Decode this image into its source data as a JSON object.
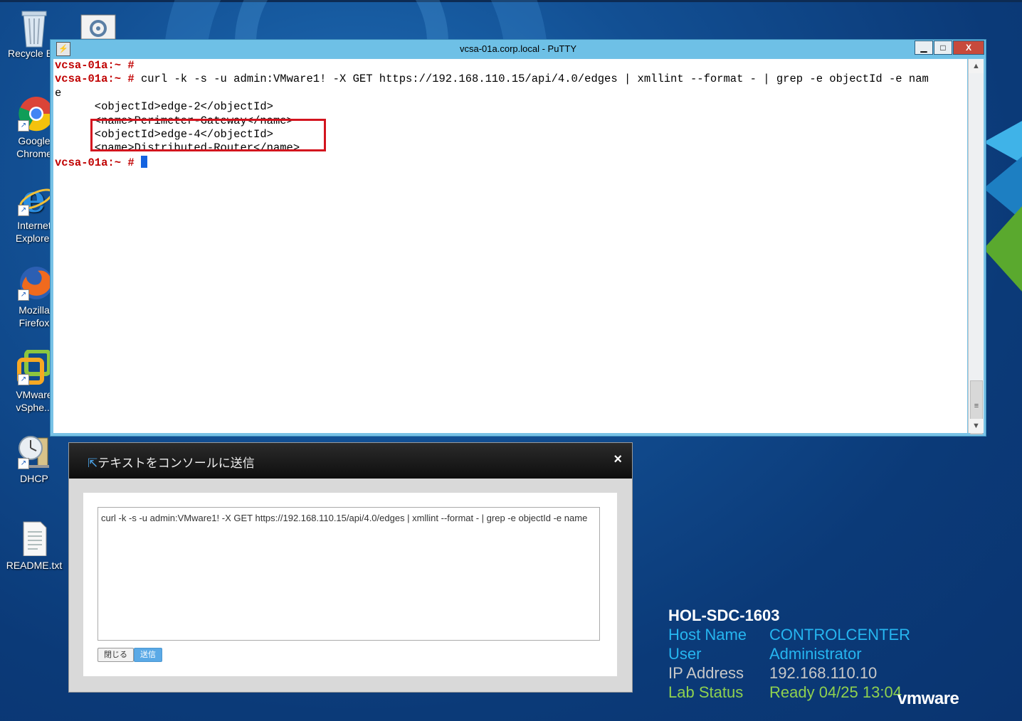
{
  "desktop": {
    "icons": [
      {
        "label1": "Recycle Bin",
        "label2": ""
      },
      {
        "label1": "Google",
        "label2": "Chrome"
      },
      {
        "label1": "Internet",
        "label2": "Explorer"
      },
      {
        "label1": "Mozilla",
        "label2": "Firefox"
      },
      {
        "label1": "VMware",
        "label2": "vSphe..."
      },
      {
        "label1": "DHCP",
        "label2": ""
      },
      {
        "label1": "README.txt",
        "label2": ""
      }
    ]
  },
  "putty": {
    "title": "vcsa-01a.corp.local - PuTTY",
    "buttons": {
      "minimize": "▁",
      "maximize": "□",
      "close": "X"
    },
    "terminal": {
      "prompt": "vcsa-01a:~ #",
      "command_line1": "curl -k -s -u admin:VMware1! -X GET https://192.168.110.15/api/4.0/edges | xmllint --format - | grep -e objectId -e nam",
      "command_line2": "e",
      "output": [
        "      <objectId>edge-2</objectId>",
        "      <name>Perimeter-Gateway</name>",
        "      <objectId>edge-4</objectId>",
        "      <name>Distributed-Router</name>"
      ]
    }
  },
  "dialog": {
    "title": "テキストをコンソールに送信",
    "close_icon": "×",
    "text": "curl -k -s -u admin:VMware1! -X GET https://192.168.110.15/api/4.0/edges | xmllint --format - | grep -e objectId -e name",
    "close_button": "閉じる",
    "send_button": "送信"
  },
  "labinfo": {
    "title": "HOL-SDC-1603",
    "host_name_label": "Host Name",
    "host_name": "CONTROLCENTER",
    "user_label": "User",
    "user": "Administrator",
    "ip_label": "IP Address",
    "ip": "192.168.110.10",
    "status_label": "Lab Status",
    "status": "Ready 04/25 13:04",
    "logo": "vmware"
  },
  "colors": {
    "prompt": "#c00000",
    "highlight_box": "#d3141e",
    "lab_blue": "#26b6f0",
    "lab_green": "#8fd14f"
  }
}
